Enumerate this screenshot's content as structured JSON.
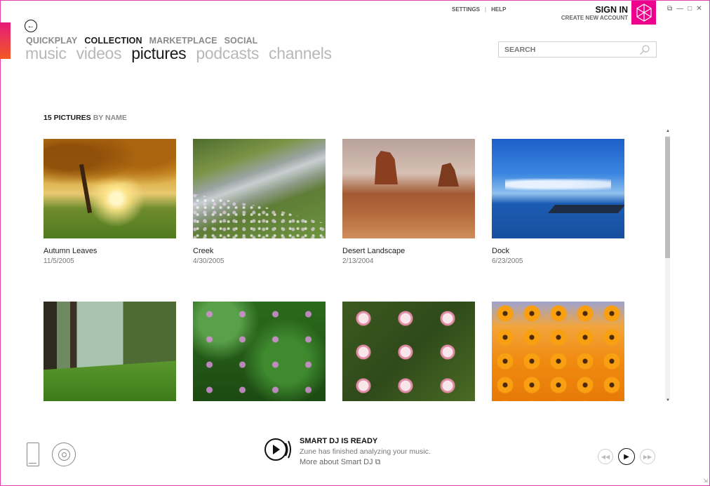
{
  "nav": {
    "pivots": [
      "QUICKPLAY",
      "COLLECTION",
      "MARKETPLACE",
      "SOCIAL"
    ],
    "active_pivot": "COLLECTION",
    "subnav": [
      "music",
      "videos",
      "pictures",
      "podcasts",
      "channels"
    ],
    "active_subnav": "pictures"
  },
  "top_links": {
    "settings": "SETTINGS",
    "separator": "|",
    "help": "HELP"
  },
  "account": {
    "sign_in": "SIGN IN",
    "create": "CREATE NEW ACCOUNT"
  },
  "search": {
    "placeholder": "SEARCH"
  },
  "collection": {
    "count_label": "15 PICTURES",
    "sort_label": "BY NAME"
  },
  "pictures": [
    {
      "name": "Autumn Leaves",
      "date": "11/5/2005"
    },
    {
      "name": "Creek",
      "date": "4/30/2005"
    },
    {
      "name": "Desert Landscape",
      "date": "2/13/2004"
    },
    {
      "name": "Dock",
      "date": "6/23/2005"
    },
    {
      "name": "",
      "date": ""
    },
    {
      "name": "",
      "date": ""
    },
    {
      "name": "",
      "date": ""
    },
    {
      "name": "",
      "date": ""
    }
  ],
  "smart_dj": {
    "title": "SMART DJ IS READY",
    "message": "Zune has finished analyzing your music.",
    "link": "More about Smart DJ"
  },
  "colors": {
    "accent": "#ec008c",
    "frame": "#e43fae"
  }
}
